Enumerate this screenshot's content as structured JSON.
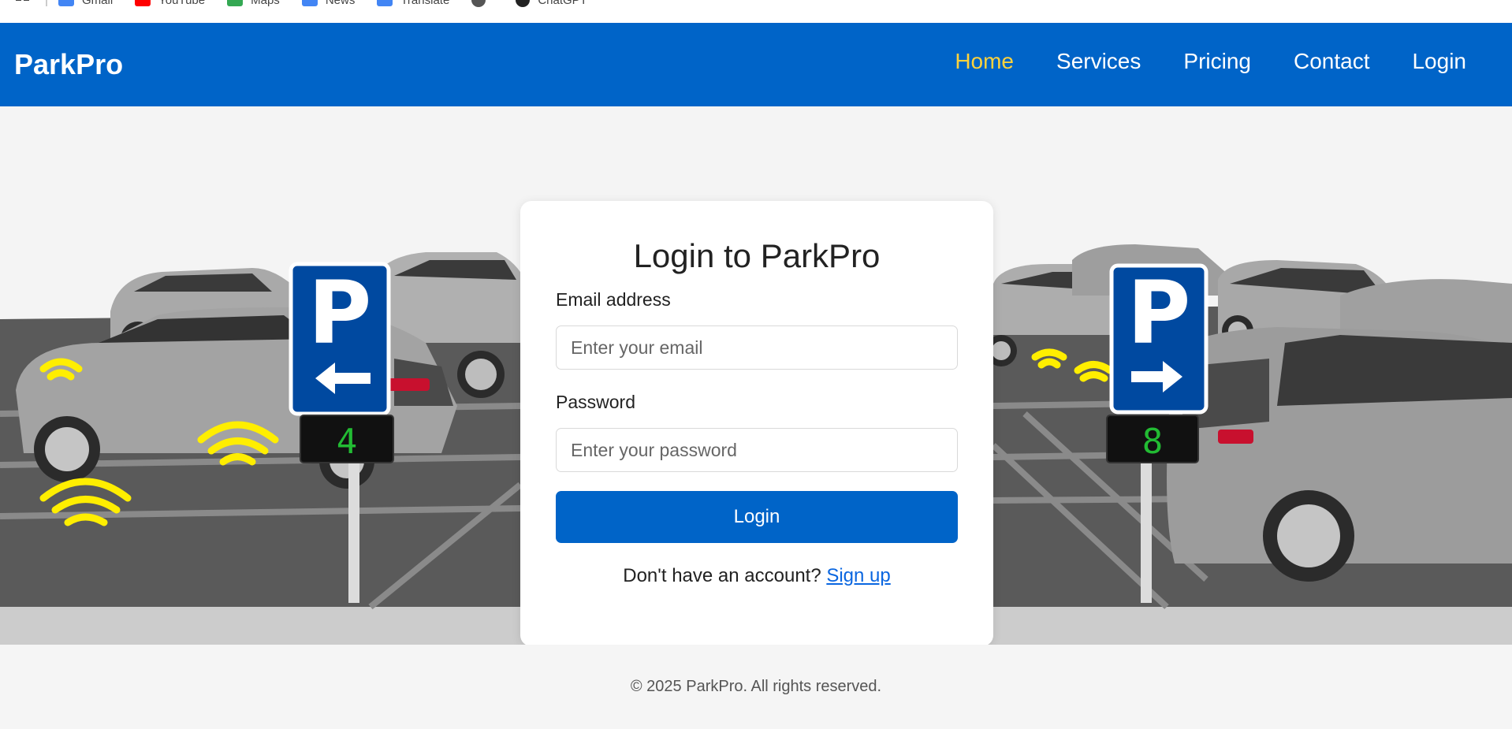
{
  "bookmarks": {
    "items": [
      {
        "label": "Gmail",
        "icon": "gmail-icon",
        "color": "#4285f4"
      },
      {
        "label": "YouTube",
        "icon": "youtube-icon",
        "color": "#ff0000"
      },
      {
        "label": "Maps",
        "icon": "maps-icon",
        "color": "#34a853"
      },
      {
        "label": "News",
        "icon": "news-icon",
        "color": "#4285f4"
      },
      {
        "label": "Translate",
        "icon": "translate-icon",
        "color": "#4285f4"
      },
      {
        "label": "",
        "icon": "globe-icon",
        "color": "#555555"
      },
      {
        "label": "ChatGPT",
        "icon": "chatgpt-icon",
        "color": "#222222"
      }
    ]
  },
  "header": {
    "brand": "ParkPro",
    "nav": [
      "Home",
      "Services",
      "Pricing",
      "Contact",
      "Login"
    ],
    "active": "Home",
    "colors": {
      "bar": "#0064c8",
      "active": "#ffd23c"
    }
  },
  "hero": {
    "left_sign": {
      "letter": "P",
      "arrow": "left",
      "count": "4"
    },
    "right_sign": {
      "letter": "P",
      "arrow": "right",
      "count": "8"
    }
  },
  "login": {
    "title": "Login to ParkPro",
    "email_label": "Email address",
    "email_placeholder": "Enter your email",
    "password_label": "Password",
    "password_placeholder": "Enter your password",
    "submit": "Login",
    "signup_prompt": "Don't have an account?",
    "signup_link": "Sign up"
  },
  "footer": {
    "text": "© 2025 ParkPro. All rights reserved."
  }
}
